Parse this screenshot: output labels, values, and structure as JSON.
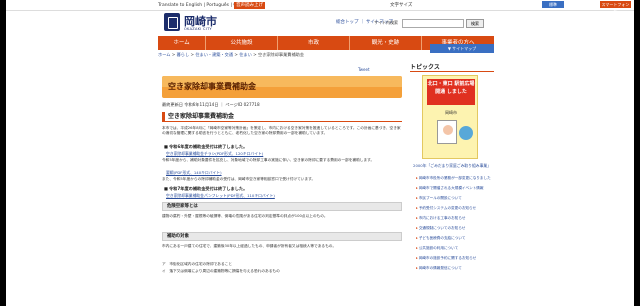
{
  "topbar": {
    "translate": "Translate to English | Português | Chinese",
    "lang": "音声読み上げ",
    "util": "文字サイズ",
    "font_size_btn": "標準",
    "smartphone_btn": "スマートフォン版"
  },
  "header": {
    "logo_title": "岡崎市",
    "logo_sub": "OKAZAKI CITY",
    "links": "総合トップ ｜ サイトマップ",
    "search_label": "サイト内検索",
    "search_placeholder": "",
    "search_button": "検索"
  },
  "gnav": {
    "items": [
      "ホーム",
      "公共施設",
      "市政",
      "観光・史跡",
      "事業者の方へ"
    ]
  },
  "breadcrumb": {
    "items": [
      "ホーム",
      "暮らし",
      "住まい・建築・交通",
      "住まい",
      "空き家除却事業費補助金"
    ],
    "history_btn": "▼ サイトマップ"
  },
  "main": {
    "tweet": "Tweet",
    "title": "空き家除却事業費補助金",
    "updated": "最終更新日 令和6年11月14日 ｜ ページID 027718",
    "subtitle": "空き家除却事業費補助金",
    "para1": "本市では、平成26年8月に「岡崎市空家等対策計画」を策定し、市内における空き家対策を推進しているところです。この計画に基づき、空き家の適切な管理に関する助言を行うとともに、老朽化した空き家の除却費用の一部を補助しています。",
    "subhead1": "令和6年度の補助金受付は終了しました。",
    "file1": "空き家除却事業補助金チラシ(PDF形式、120キロバイト)",
    "para2": "令和5年度から、補助対象要件を拡充し、対象地域での除却工事の実施に伴い、空き家の除却に要する費用の一部を補助します。",
    "file2": "要綱(PDF形式、140キロバイト)",
    "para3": "また、令和5年度からの除却補助金の受付は、岡崎市空き家等相談窓口で受け付けています。",
    "subhead2": "令和7年度の補助金受付は終了しました。",
    "file3": "空き家除却事業補助金パンフレット(PDF形式、110キロバイト)",
    "box1": "危険空家等とは",
    "para4": "建物の腐朽・外壁・屋根等の破損等、倒壊の危険がある住宅の判定基準の評点が100点以上のもの。",
    "box2": "補助の対象",
    "para5": "市内にある一戸建ての住宅で、建築後30年以上経過したもの、申請者が所有者又は相続人等であるもの。",
    "list1": "ア　市街化区域内の住宅の除却であること",
    "list2": "イ　落下又は倒壊により周辺の建築物等に損傷を与える恐れのあるもの"
  },
  "sidebar": {
    "head": "トピックス",
    "banner_a": "北口・東口 駅前広場開通 しました",
    "banner_b": "岡崎市",
    "banner_cap": "2000年「ごみだまり家庭ごみ取り組み事業」",
    "topics": [
      "岡崎市市役所の業務が一部変更になりました",
      "岡崎市で開催される大規模イベント情報",
      "市民プールの開設について",
      "予約受付システムの変更のお知らせ",
      "市内における工事のお知らせ",
      "交通規制についてのお知らせ",
      "子ども医療費の支給について",
      "公共施設の利用について",
      "岡崎市の施設予約に関するお知らせ",
      "岡崎市の情報発信について"
    ]
  }
}
